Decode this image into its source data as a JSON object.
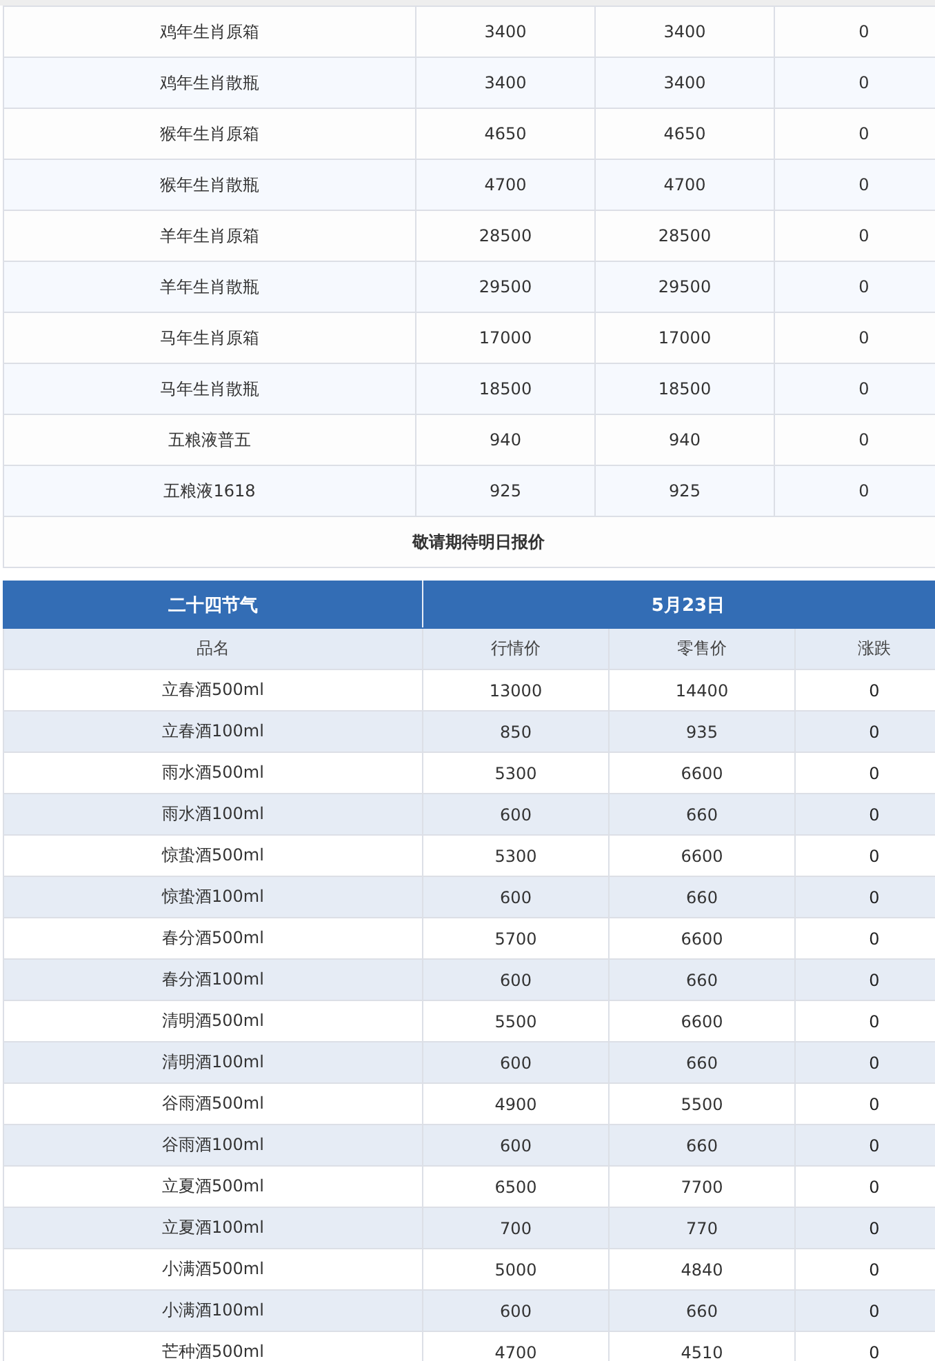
{
  "zodiac_table": {
    "rows": [
      {
        "name": "鸡年生肖原箱",
        "market_price": "3400",
        "retail_price": "3400",
        "change": "0"
      },
      {
        "name": "鸡年生肖散瓶",
        "market_price": "3400",
        "retail_price": "3400",
        "change": "0"
      },
      {
        "name": "猴年生肖原箱",
        "market_price": "4650",
        "retail_price": "4650",
        "change": "0"
      },
      {
        "name": "猴年生肖散瓶",
        "market_price": "4700",
        "retail_price": "4700",
        "change": "0"
      },
      {
        "name": "羊年生肖原箱",
        "market_price": "28500",
        "retail_price": "28500",
        "change": "0"
      },
      {
        "name": "羊年生肖散瓶",
        "market_price": "29500",
        "retail_price": "29500",
        "change": "0"
      },
      {
        "name": "马年生肖原箱",
        "market_price": "17000",
        "retail_price": "17000",
        "change": "0"
      },
      {
        "name": "马年生肖散瓶",
        "market_price": "18500",
        "retail_price": "18500",
        "change": "0"
      },
      {
        "name": "五粮液普五",
        "market_price": "940",
        "retail_price": "940",
        "change": "0"
      },
      {
        "name": "五粮液1618",
        "market_price": "925",
        "retail_price": "925",
        "change": "0"
      }
    ],
    "footer": "敬请期待明日报价"
  },
  "solar_terms_table": {
    "title": "二十四节气",
    "date": "5月23日",
    "columns": [
      "品名",
      "行情价",
      "零售价",
      "涨跌"
    ],
    "rows": [
      {
        "name": "立春酒500ml",
        "market_price": "13000",
        "retail_price": "14400",
        "change": "0"
      },
      {
        "name": "立春酒100ml",
        "market_price": "850",
        "retail_price": "935",
        "change": "0"
      },
      {
        "name": "雨水酒500ml",
        "market_price": "5300",
        "retail_price": "6600",
        "change": "0"
      },
      {
        "name": "雨水酒100ml",
        "market_price": "600",
        "retail_price": "660",
        "change": "0"
      },
      {
        "name": "惊蛰酒500ml",
        "market_price": "5300",
        "retail_price": "6600",
        "change": "0"
      },
      {
        "name": "惊蛰酒100ml",
        "market_price": "600",
        "retail_price": "660",
        "change": "0"
      },
      {
        "name": "春分酒500ml",
        "market_price": "5700",
        "retail_price": "6600",
        "change": "0"
      },
      {
        "name": "春分酒100ml",
        "market_price": "600",
        "retail_price": "660",
        "change": "0"
      },
      {
        "name": "清明酒500ml",
        "market_price": "5500",
        "retail_price": "6600",
        "change": "0"
      },
      {
        "name": "清明酒100ml",
        "market_price": "600",
        "retail_price": "660",
        "change": "0"
      },
      {
        "name": "谷雨酒500ml",
        "market_price": "4900",
        "retail_price": "5500",
        "change": "0"
      },
      {
        "name": "谷雨酒100ml",
        "market_price": "600",
        "retail_price": "660",
        "change": "0"
      },
      {
        "name": "立夏酒500ml",
        "market_price": "6500",
        "retail_price": "7700",
        "change": "0"
      },
      {
        "name": "立夏酒100ml",
        "market_price": "700",
        "retail_price": "770",
        "change": "0"
      },
      {
        "name": "小满酒500ml",
        "market_price": "5000",
        "retail_price": "4840",
        "change": "0"
      },
      {
        "name": "小满酒100ml",
        "market_price": "600",
        "retail_price": "660",
        "change": "0"
      },
      {
        "name": "芒种酒500ml",
        "market_price": "4700",
        "retail_price": "4510",
        "change": "0"
      }
    ]
  }
}
